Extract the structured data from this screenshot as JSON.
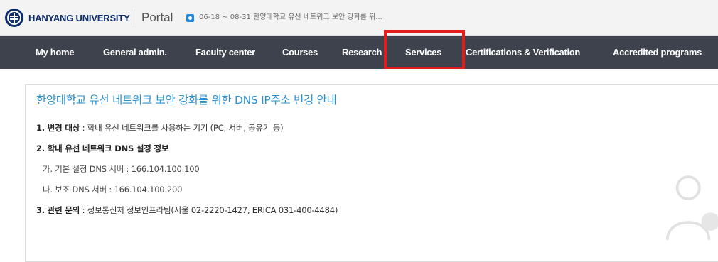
{
  "header": {
    "logo_text": "HANYANG UNIVERSITY",
    "logo_icon": "university-emblem-icon",
    "portal_label": "Portal",
    "notice_icon": "notice-icon",
    "notice_text": "06-18 ~ 08-31 한양대학교 유선 네트워크 보안 강화를 위..."
  },
  "nav": {
    "items": [
      {
        "label": "My home"
      },
      {
        "label": "General admin."
      },
      {
        "label": "Faculty center"
      },
      {
        "label": "Courses"
      },
      {
        "label": "Research"
      },
      {
        "label": "Services"
      },
      {
        "label": "Certifications & Verification"
      },
      {
        "label": "Accredited programs"
      }
    ],
    "highlighted": "Services",
    "colors": {
      "bar": "#3e424c",
      "highlight": "#e21c1c"
    }
  },
  "notice": {
    "title": "한양대학교 유선 네트워크 보안 강화를 위한 DNS IP주소 변경 안내",
    "line1_label": "1. 변경 대상",
    "line1_text": " : 학내 유선 네트워크를 사용하는 기기 (PC, 서버, 공유기 등)",
    "line2_label": "2. 학내 유선 네트워크 DNS 설정 정보",
    "line2a_text": "가. 기본 설정 DNS 서버 : 166.104.100.100",
    "line2b_text": "나. 보조 DNS 서버 : 166.104.100.200",
    "line3_label": "3. 관련 문의",
    "line3_text": " : 정보통신처 정보인프라팀(서울 02-2220-1427, ERICA 031-400-4484)",
    "title_color": "#2b8fcf"
  },
  "decor": {
    "user_icon": "user-icon"
  }
}
